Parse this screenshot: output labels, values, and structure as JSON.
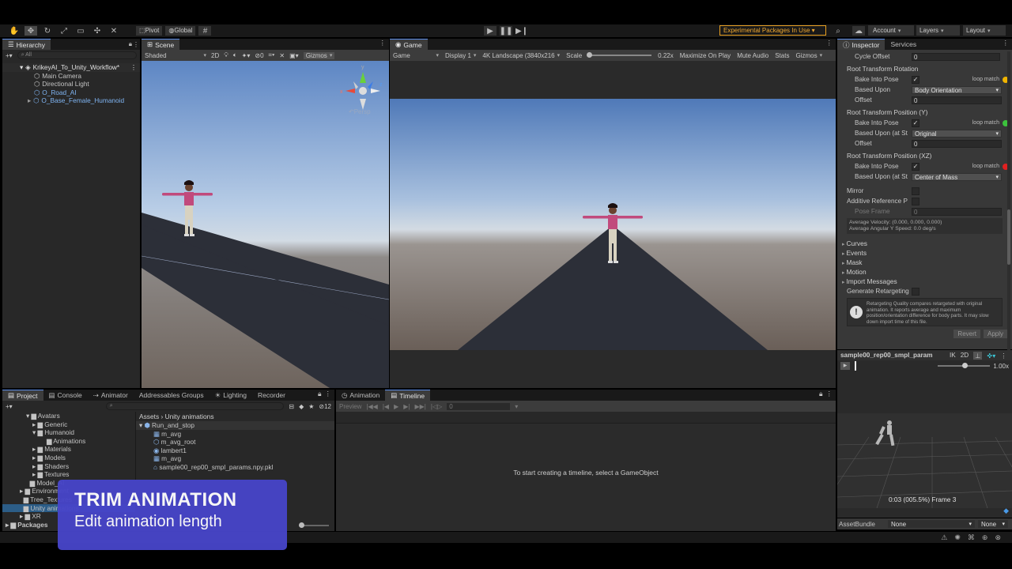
{
  "toolbar": {
    "pivot": "Pivot",
    "global": "Global",
    "experimental": "Experimental Packages In Use",
    "account": "Account",
    "layers": "Layers",
    "layout": "Layout"
  },
  "hierarchy": {
    "tab": "Hierarchy",
    "search_placeholder": "All",
    "items": [
      "KrikeyAI_To_Unity_Workflow*",
      "Main Camera",
      "Directional Light",
      "O_Road_AI",
      "O_Base_Female_Humanoid"
    ]
  },
  "scene": {
    "tab": "Scene",
    "shading": "Shaded",
    "mode2d": "2D",
    "gizmos": "Gizmos",
    "persp": "Persp",
    "hidden_count": "0"
  },
  "game": {
    "tab": "Game",
    "display_mode": "Game",
    "display": "Display 1",
    "resolution": "4K Landscape (3840x216",
    "scale_label": "Scale",
    "scale_value": "0.22x",
    "maximize": "Maximize On Play",
    "mute": "Mute Audio",
    "stats": "Stats",
    "gizmos": "Gizmos"
  },
  "inspector": {
    "tab": "Inspector",
    "services": "Services",
    "cycle_offset_label": "Cycle Offset",
    "cycle_offset_value": "0",
    "rot_header": "Root Transform Rotation",
    "bake": "Bake Into Pose",
    "loop_match": "loop match",
    "based_upon": "Based Upon",
    "rot_based": "Body Orientation",
    "offset": "Offset",
    "rot_offset": "0",
    "posy_header": "Root Transform Position (Y)",
    "based_upon_at": "Based Upon (at St",
    "posy_based": "Original",
    "posy_offset": "0",
    "posxz_header": "Root Transform Position (XZ)",
    "posxz_based": "Center of Mass",
    "mirror": "Mirror",
    "additive": "Additive Reference P",
    "pose_frame": "Pose Frame",
    "pose_frame_value": "0",
    "avg_velocity": "Average Velocity: (0.000, 0.000, 0.000)",
    "avg_angular": "Average Angular Y Speed: 0.0 deg/s",
    "foldouts": [
      "Curves",
      "Events",
      "Mask",
      "Motion"
    ],
    "import_messages": "Import Messages",
    "generate_retargeting": "Generate Retargeting",
    "info_text": "Retargeting Quality compares retargeted with original animation. It reports average and maximum position/orientation difference for body parts. It may slow down import time of this file.",
    "revert": "Revert",
    "apply": "Apply",
    "loop_colors": [
      "#f0b400",
      "#3cc23c",
      "#e02020"
    ]
  },
  "preview": {
    "clip_name": "sample00_rep00_smpl_param",
    "ik": "IK",
    "mode2d": "2D",
    "speed": "1.00x",
    "time": "0:03 (005.5%) Frame 3"
  },
  "assetbundle": {
    "label": "AssetBundle",
    "value": "None",
    "variant": "None"
  },
  "bottom_tabs": [
    "Project",
    "Console",
    "Animator",
    "Addressables Groups",
    "Lighting",
    "Recorder"
  ],
  "project": {
    "count": "12",
    "tree": [
      "Avatars",
      "Generic",
      "Humanoid",
      "Animations",
      "Materials",
      "Models",
      "Shaders",
      "Textures",
      "Model_AI",
      "Environment",
      "Tree_Textures",
      "Unity animations",
      "XR",
      "Packages"
    ],
    "breadcrumb": [
      "Assets",
      "Unity animations"
    ],
    "files": [
      "Run_and_stop",
      "m_avg",
      "m_avg_root",
      "lambert1",
      "m_avg",
      "sample00_rep00_smpl_params.npy.pkl"
    ]
  },
  "animation": {
    "tab": "Animation",
    "timeline_tab": "Timeline",
    "preview": "Preview",
    "frame": "0",
    "empty_msg": "To start creating a timeline, select a GameObject"
  },
  "overlay": {
    "title": "TRIM ANIMATION",
    "subtitle": "Edit animation length"
  }
}
